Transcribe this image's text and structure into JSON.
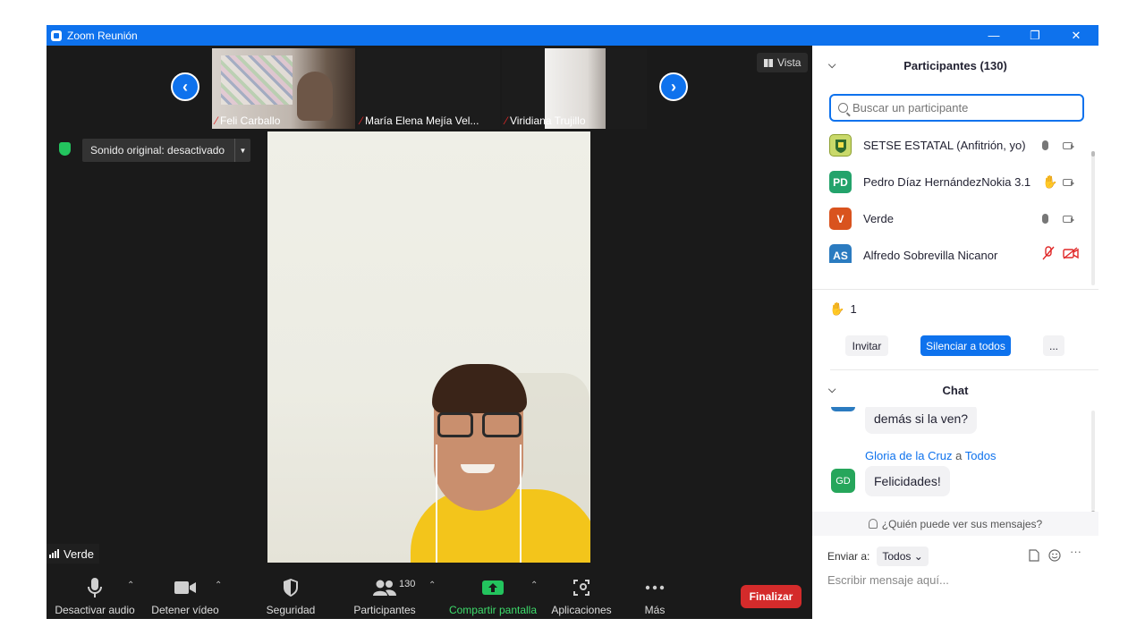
{
  "window": {
    "title": "Zoom Reunión",
    "controls": {
      "minimize": "—",
      "restore": "❐",
      "close": "✕"
    }
  },
  "video": {
    "thumbnails": [
      {
        "name": "Feli Carballo",
        "muted": true
      },
      {
        "name": "María Elena Mejía Vel...",
        "muted": true
      },
      {
        "name": "Viridiana Trujillo",
        "muted": true
      }
    ],
    "view_button": "Vista",
    "original_sound": "Sonido original: desactivado",
    "active_speaker": "Verde"
  },
  "toolbar": {
    "audio": "Desactivar audio",
    "video": "Detener vídeo",
    "security": "Seguridad",
    "participants": "Participantes",
    "participants_count": "130",
    "share": "Compartir pantalla",
    "apps": "Aplicaciones",
    "more": "Más",
    "end": "Finalizar"
  },
  "participants_panel": {
    "title": "Participantes (130)",
    "search_placeholder": "Buscar un participante",
    "list": [
      {
        "name": "SETSE ESTATAL (Anfitrión, yo)",
        "initials": "",
        "avatar_color": "#c9d96a",
        "status": "mic"
      },
      {
        "name": "Pedro Díaz HernándezNokia 3.1",
        "initials": "PD",
        "avatar_color": "#23a36b",
        "status": "hand"
      },
      {
        "name": "Verde",
        "initials": "V",
        "avatar_color": "#d9531e",
        "status": "mic"
      },
      {
        "name": "Alfredo Sobrevilla Nicanor",
        "initials": "AS",
        "avatar_color": "#2b7bc0",
        "status": "muted"
      }
    ],
    "raised_hands": "1",
    "invite": "Invitar",
    "mute_all": "Silenciar a todos",
    "more": "..."
  },
  "chat": {
    "title": "Chat",
    "messages": [
      {
        "text": "demás si la ven?"
      },
      {
        "sender": "Gloria de la Cruz",
        "to_word": "a",
        "recipient": "Todos",
        "initials": "GD",
        "text": "Felicidades!"
      }
    ],
    "who_can_see": "¿Quién puede ver sus mensajes?",
    "send_to_label": "Enviar a:",
    "send_to_value": "Todos",
    "input_placeholder": "Escribir mensaje aquí..."
  },
  "colors": {
    "zoom_blue": "#0e72ed",
    "end_red": "#d42b2b",
    "share_green": "#23c45e"
  }
}
